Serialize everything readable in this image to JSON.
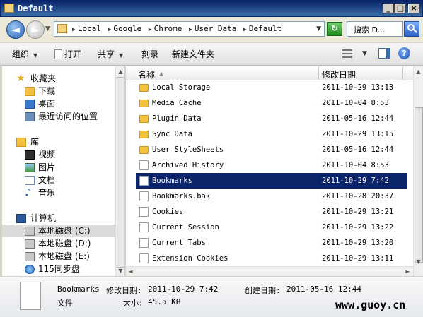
{
  "window": {
    "title": "Default"
  },
  "address": {
    "crumbs": [
      "Local",
      "Google",
      "Chrome",
      "User Data",
      "Default"
    ],
    "search_placeholder": "搜索 D..."
  },
  "toolbar": {
    "organize": "组织",
    "open": "打开",
    "share": "共享",
    "burn": "刻录",
    "new_folder": "新建文件夹"
  },
  "nav": {
    "favorites": "收藏夹",
    "downloads": "下载",
    "desktop": "桌面",
    "recent": "最近访问的位置",
    "library": "库",
    "videos": "视频",
    "pictures": "图片",
    "documents": "文档",
    "music": "音乐",
    "computer": "计算机",
    "drive_c": "本地磁盘 (C:)",
    "drive_d": "本地磁盘 (D:)",
    "drive_e": "本地磁盘 (E:)",
    "sync115": "115同步盘"
  },
  "columns": {
    "name": "名称",
    "modified": "修改日期"
  },
  "files": [
    {
      "name": "Local Storage",
      "date": "2011-10-29 13:13",
      "type": "folder"
    },
    {
      "name": "Media Cache",
      "date": "2011-10-04 8:53",
      "type": "folder"
    },
    {
      "name": "Plugin Data",
      "date": "2011-05-16 12:44",
      "type": "folder"
    },
    {
      "name": "Sync Data",
      "date": "2011-10-29 13:15",
      "type": "folder"
    },
    {
      "name": "User StyleSheets",
      "date": "2011-05-16 12:44",
      "type": "folder"
    },
    {
      "name": "Archived History",
      "date": "2011-10-04 8:53",
      "type": "file"
    },
    {
      "name": "Bookmarks",
      "date": "2011-10-29 7:42",
      "type": "file"
    },
    {
      "name": "Bookmarks.bak",
      "date": "2011-10-28 20:37",
      "type": "file"
    },
    {
      "name": "Cookies",
      "date": "2011-10-29 13:21",
      "type": "file"
    },
    {
      "name": "Current Session",
      "date": "2011-10-29 13:22",
      "type": "file"
    },
    {
      "name": "Current Tabs",
      "date": "2011-10-29 13:20",
      "type": "file"
    },
    {
      "name": "Extension Cookies",
      "date": "2011-10-29 13:11",
      "type": "file"
    }
  ],
  "details": {
    "name": "Bookmarks",
    "modified_label": "修改日期:",
    "modified_value": "2011-10-29 7:42",
    "created_label": "创建日期:",
    "created_value": "2011-05-16 12:44",
    "type": "文件",
    "size_label": "大小:",
    "size_value": "45.5 KB"
  },
  "watermark": "www.guoy.cn"
}
